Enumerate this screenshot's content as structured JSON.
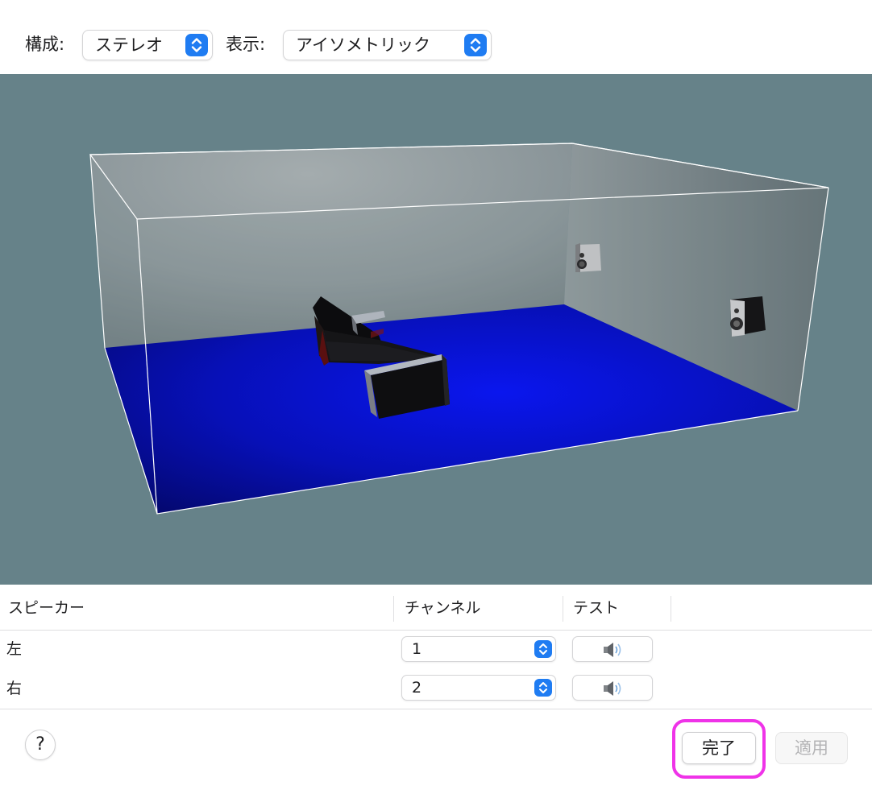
{
  "toolbar": {
    "config_label": "構成:",
    "config_value": "ステレオ",
    "view_label": "表示:",
    "view_value": "アイソメトリック"
  },
  "scene": {
    "colors": {
      "background": "#668289",
      "floor": "#0a12c8",
      "wall": "#8a9599",
      "edges": "#ffffff"
    },
    "objects": [
      "sofa",
      "speaker-left",
      "speaker-right"
    ]
  },
  "table": {
    "headers": {
      "speaker": "スピーカー",
      "channel": "チャンネル",
      "test": "テスト"
    },
    "rows": [
      {
        "name": "左",
        "channel": "1"
      },
      {
        "name": "右",
        "channel": "2"
      }
    ]
  },
  "buttons": {
    "help": "?",
    "done": "完了",
    "apply": "適用"
  },
  "colors": {
    "accent": "#1f7cf2",
    "highlight": "#ef33e8"
  }
}
